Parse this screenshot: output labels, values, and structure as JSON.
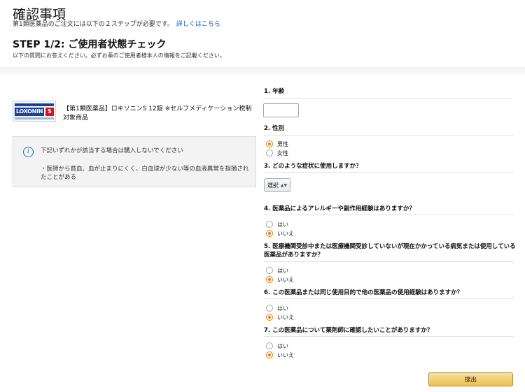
{
  "page": {
    "title": "確認事項",
    "intro": "第1類医薬品のご注文には以下の２ステップが必要です。",
    "intro_link": "詳しくはこちら"
  },
  "step": {
    "title": "STEP 1/2: ご使用者状態チェック",
    "subtitle": "以下の質問にお答えください。必ずお薬のご使用者様本人の情報をご記載ください。"
  },
  "product": {
    "image_logo": "LOXONIN",
    "image_logo_suffix": "S",
    "name": "【第1類医薬品】ロキソニンS 12錠 ※セルフメディケーション税制対象商品"
  },
  "notice": {
    "line1": "下記いずれかが該当する場合は購入しないでください",
    "line2": "・医師から貧血、血が止まりにくく、白血球が少ない等の血液異常を指摘されたことがある"
  },
  "questions": {
    "q1": {
      "label": "1. 年齢",
      "value": ""
    },
    "q2": {
      "label": "2. 性別",
      "options": [
        "男性",
        "女性"
      ],
      "selected": "男性"
    },
    "q3": {
      "label": "3. どのような症状に使用しますか？",
      "select_label": "選択"
    },
    "q4": {
      "label": "4. 医薬品によるアレルギーや副作用経験はありますか？",
      "options": [
        "はい",
        "いいえ"
      ],
      "selected": "いいえ"
    },
    "q5": {
      "label": "5. 医療機関受診中または医療機関受診していないが現在かかっている病気または使用している医薬品がありますか？",
      "options": [
        "はい",
        "いいえ"
      ],
      "selected": "いいえ"
    },
    "q6": {
      "label": "6. この医薬品または同じ使用目的で他の医薬品の使用経験はありますか？",
      "options": [
        "はい",
        "いいえ"
      ],
      "selected": "いいえ"
    },
    "q7": {
      "label": "7. この医薬品について薬剤師に確認したいことがありますか？",
      "options": [
        "はい",
        "いいえ"
      ],
      "selected": "いいえ"
    }
  },
  "submit": {
    "label": "提出"
  },
  "colors": {
    "accent": "#e47911",
    "link": "#0066c0",
    "button": "#f0c14b"
  }
}
